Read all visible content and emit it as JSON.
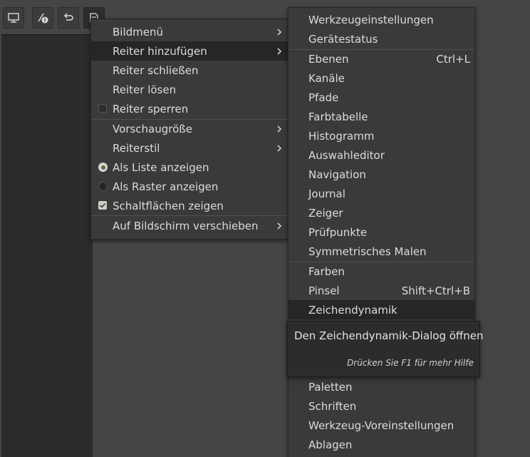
{
  "toolbar": {
    "buttons": [
      {
        "icon": "display-icon"
      },
      {
        "icon": "pointer-info-icon"
      },
      {
        "icon": "undo-history-icon"
      },
      {
        "icon": "document-tab-menu-icon"
      }
    ]
  },
  "main_menu": {
    "items": [
      {
        "label": "Bildmenü",
        "submenu": true
      },
      {
        "label": "Reiter hinzufügen",
        "submenu": true,
        "highlighted": true
      },
      {
        "label": "Reiter schließen"
      },
      {
        "label": "Reiter lösen"
      },
      {
        "label": "Reiter sperren",
        "checkbox": false
      },
      {
        "label": "Vorschaugröße",
        "submenu": true
      },
      {
        "label": "Reiterstil",
        "submenu": true
      },
      {
        "label": "Als Liste anzeigen",
        "radio": true
      },
      {
        "label": "Als Raster anzeigen",
        "radio": false
      },
      {
        "label": "Schaltflächen zeigen",
        "checkbox": true
      },
      {
        "label": "Auf Bildschirm verschieben",
        "submenu": true
      }
    ]
  },
  "sub_menu": {
    "items": [
      {
        "label": "Werkzeugeinstellungen"
      },
      {
        "label": "Gerätestatus"
      },
      {
        "label": "Ebenen",
        "shortcut": "Ctrl+L"
      },
      {
        "label": "Kanäle"
      },
      {
        "label": "Pfade"
      },
      {
        "label": "Farbtabelle"
      },
      {
        "label": "Histogramm"
      },
      {
        "label": "Auswahleditor"
      },
      {
        "label": "Navigation"
      },
      {
        "label": "Journal"
      },
      {
        "label": "Zeiger"
      },
      {
        "label": "Prüfpunkte"
      },
      {
        "label": "Symmetrisches Malen"
      },
      {
        "label": "Farben"
      },
      {
        "label": "Pinsel",
        "shortcut": "Shift+Ctrl+B"
      },
      {
        "label": "Zeichendynamik",
        "highlighted": true
      },
      {
        "label": "Paletten"
      },
      {
        "label": "Schriften"
      },
      {
        "label": "Werkzeug-Voreinstellungen"
      },
      {
        "label": "Ablagen"
      }
    ]
  },
  "tooltip": {
    "title": "Den Zeichendynamik-Dialog öffnen",
    "hint": "Drücken Sie F1 für mehr Hilfe"
  },
  "colors": {
    "menu_bg": "#3a3a3a",
    "highlight_bg": "#262626",
    "text": "#dcdcdc",
    "radio_dot": "#55703f"
  }
}
